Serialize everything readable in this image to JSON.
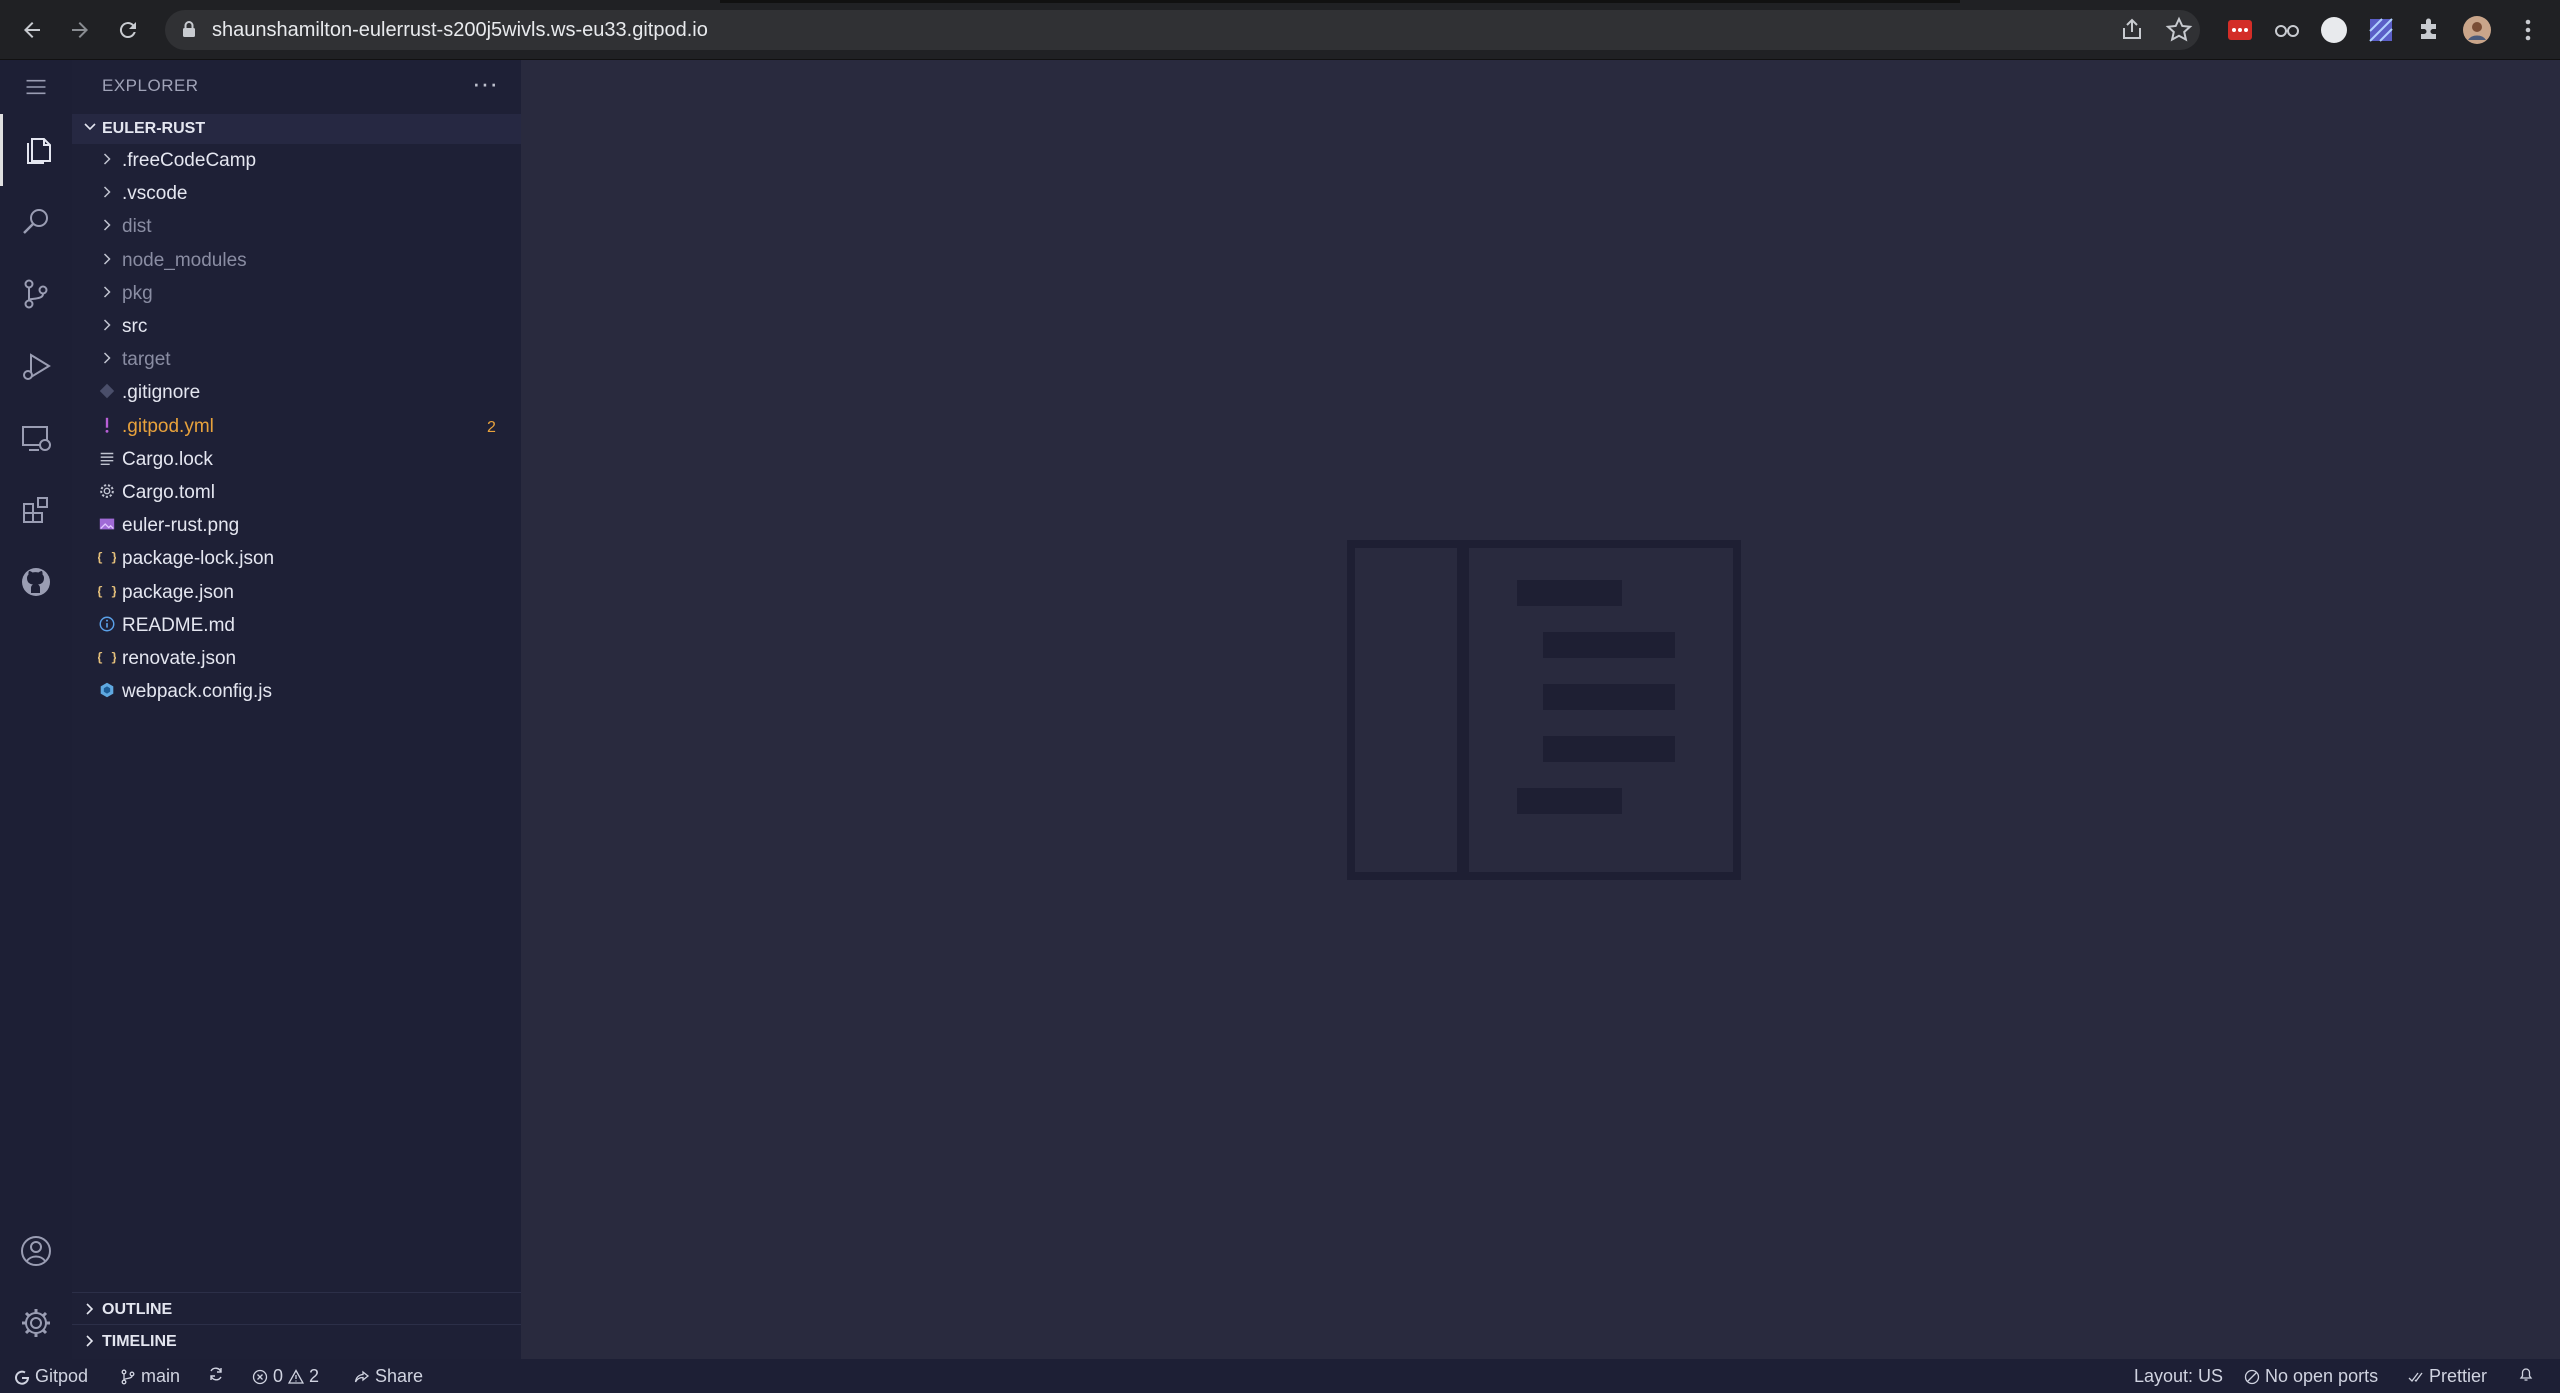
{
  "browser": {
    "url": "shaunshamilton-eulerrust-s200j5wivls.ws-eu33.gitpod.io"
  },
  "explorer": {
    "header": "EXPLORER",
    "more": "···",
    "workspace": "EULER-RUST",
    "items": [
      {
        "name": ".freeCodeCamp",
        "kind": "folder",
        "color": "#e4e6f0"
      },
      {
        "name": ".vscode",
        "kind": "folder",
        "color": "#e4e6f0"
      },
      {
        "name": "dist",
        "kind": "folder",
        "color": "#8a8da3"
      },
      {
        "name": "node_modules",
        "kind": "folder",
        "color": "#8a8da3"
      },
      {
        "name": "pkg",
        "kind": "folder",
        "color": "#8a8da3"
      },
      {
        "name": "src",
        "kind": "folder",
        "color": "#e4e6f0"
      },
      {
        "name": "target",
        "kind": "folder",
        "color": "#8a8da3"
      },
      {
        "name": ".gitignore",
        "kind": "file",
        "icon": "git-icon",
        "color": "#e4e6f0"
      },
      {
        "name": ".gitpod.yml",
        "kind": "file",
        "icon": "warning-exclamation-icon",
        "color": "#e8a23c",
        "badge": "2"
      },
      {
        "name": "Cargo.lock",
        "kind": "file",
        "icon": "lines-icon",
        "color": "#e4e6f0"
      },
      {
        "name": "Cargo.toml",
        "kind": "file",
        "icon": "gear-icon",
        "color": "#e4e6f0"
      },
      {
        "name": "euler-rust.png",
        "kind": "file",
        "icon": "image-icon",
        "color": "#e4e6f0"
      },
      {
        "name": "package-lock.json",
        "kind": "file",
        "icon": "json-icon",
        "color": "#e4e6f0"
      },
      {
        "name": "package.json",
        "kind": "file",
        "icon": "json-icon",
        "color": "#e4e6f0"
      },
      {
        "name": "README.md",
        "kind": "file",
        "icon": "info-icon",
        "color": "#e4e6f0"
      },
      {
        "name": "renovate.json",
        "kind": "file",
        "icon": "json-icon",
        "color": "#e4e6f0"
      },
      {
        "name": "webpack.config.js",
        "kind": "file",
        "icon": "webpack-icon",
        "color": "#e4e6f0"
      }
    ]
  },
  "sections": {
    "outline": "OUTLINE",
    "timeline": "TIMELINE"
  },
  "status": {
    "gitpod": "Gitpod",
    "branch": "main",
    "errors": "0",
    "warnings": "2",
    "share": "Share",
    "layout": "Layout: US",
    "ports": "No open ports",
    "prettier": "Prettier"
  },
  "colors": {
    "accent_warning": "#e8a23c",
    "json_icon": "#e5c07b",
    "editor_bg": "#292a3e",
    "sidebar_bg": "#1e2036"
  }
}
